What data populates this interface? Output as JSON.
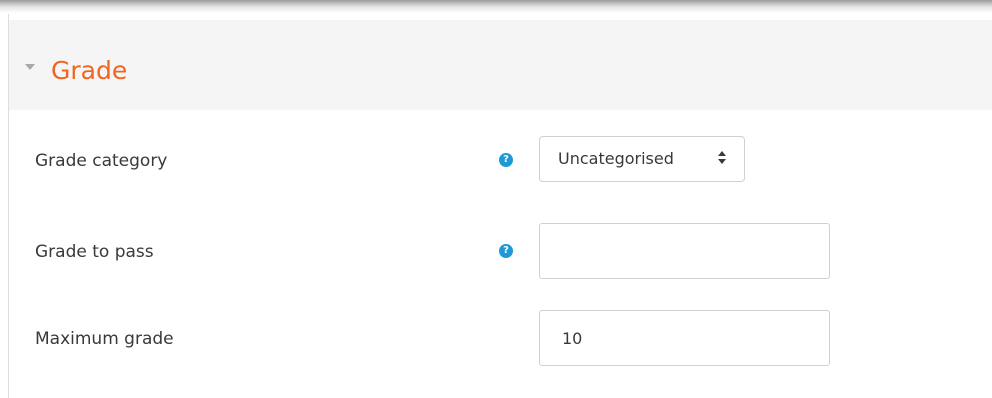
{
  "section": {
    "title": "Grade",
    "expanded": true
  },
  "fields": {
    "grade_category": {
      "label": "Grade category",
      "help_icon": "question-circle-icon",
      "selected": "Uncategorised"
    },
    "grade_to_pass": {
      "label": "Grade to pass",
      "help_icon": "question-circle-icon",
      "value": ""
    },
    "maximum_grade": {
      "label": "Maximum grade",
      "value": "10"
    }
  },
  "colors": {
    "section_title": "#f06521",
    "help_icon": "#1d9ad6",
    "header_bg": "#f5f5f5",
    "text": "#373a3c",
    "border": "#d0d0d0"
  }
}
